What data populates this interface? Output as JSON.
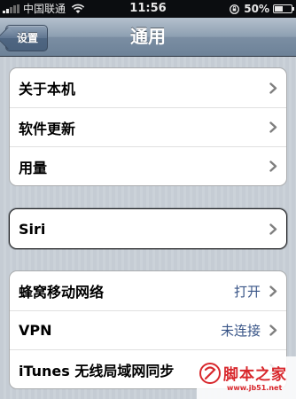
{
  "status_bar": {
    "carrier": "中国联通",
    "time": "11:56",
    "battery_percent": "50%",
    "battery_level": 0.5,
    "signal_bars": 2,
    "icons": [
      "signal-icon",
      "wifi-icon",
      "orientation-lock-icon",
      "battery-icon"
    ]
  },
  "nav": {
    "back_label": "设置",
    "title": "通用"
  },
  "groups": {
    "info": [
      {
        "label": "关于本机"
      },
      {
        "label": "软件更新"
      },
      {
        "label": "用量"
      }
    ],
    "siri": {
      "label": "Siri"
    },
    "network": [
      {
        "label": "蜂窝移动网络",
        "value": "打开"
      },
      {
        "label": "VPN",
        "value": "未连接"
      },
      {
        "label": "iTunes 无线局域网同步"
      }
    ]
  },
  "watermark": {
    "title": "脚本之家",
    "url": "www.jb51.net"
  },
  "colors": {
    "nav_bar": "#7b8ea3",
    "value_text": "#385487",
    "chevron": "#7f7f7f",
    "watermark": "#d8282d"
  }
}
